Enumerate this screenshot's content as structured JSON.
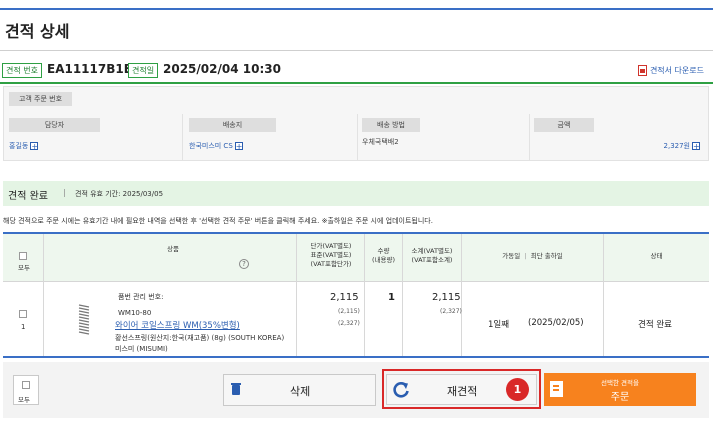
{
  "page": {
    "title": "견적 상세"
  },
  "quote": {
    "number_label": "견적 번호",
    "number": "EA11117B1E",
    "date_label": "견적일",
    "date": "2025/02/04 10:30",
    "download_label": "견적서 다운로드",
    "download_icon": "pdf-icon"
  },
  "info": {
    "customer_order_label": "고객 주문 번호",
    "columns": [
      {
        "label": "담당자",
        "value": "홍길동",
        "has_plus": true
      },
      {
        "label": "배송지",
        "value": "한국미스미 CS",
        "has_plus": true
      },
      {
        "label": "배송 방법",
        "value": "우체국택배2",
        "has_plus": false
      },
      {
        "label": "금액",
        "value": "2,327원",
        "has_plus": true
      }
    ]
  },
  "status": {
    "main": "견적 완료",
    "separator": "|",
    "validity": "견적 유효 기간: 2025/03/05"
  },
  "notice": "해당 견적으로 주문 시에는 유효기간 내에 필요한 내역을 선택한 후 '선택한 견적 주문' 버튼을 클릭해 주세요. ※출하일은 주문 시에 업데이트됩니다.",
  "table": {
    "headers": {
      "select_all": "모두",
      "product": "상품",
      "unit_price_1": "단가(VAT별도)",
      "unit_price_2": "표준(VAT별도)",
      "unit_price_3": "(VAT포함단가)",
      "qty_1": "수량",
      "qty_2": "(내용량)",
      "subtotal_1": "소계(VAT별도)",
      "subtotal_2": "(VAT포함소계)",
      "ship_days": "가동일",
      "ship_sep": "|",
      "ship_date": "최단 출하일",
      "status": "상태"
    },
    "rows": [
      {
        "index": "1",
        "mgmt_label": "품번 관리 번호:",
        "part_no": "WM10-80",
        "name": "와이어 코일스프링 WM(35%변형)",
        "maker_line": "황선스프링(원산지:한국(재고품) (8g) (SOUTH KOREA)",
        "maker": "미스미 (MISUMI)",
        "unit_price": "2,115",
        "std_price": "(2,115)",
        "vat_price": "(2,327)",
        "qty": "1",
        "subtotal": "2,115",
        "subtotal_vat": "(2,327)",
        "days": "1일째",
        "ship_date": "(2025/02/05)",
        "status": "견적 완료"
      }
    ]
  },
  "footer": {
    "select_all": "모두",
    "delete_label": "삭제",
    "requote_label": "재견적",
    "order_line1": "선택한 견적을",
    "order_line2": "주문",
    "marker": "1"
  },
  "colors": {
    "accent_blue": "#3a6fc6",
    "green": "#2ea043",
    "status_bg": "#e4f4e4",
    "order_orange": "#f7821e",
    "highlight_red": "#d92828"
  }
}
